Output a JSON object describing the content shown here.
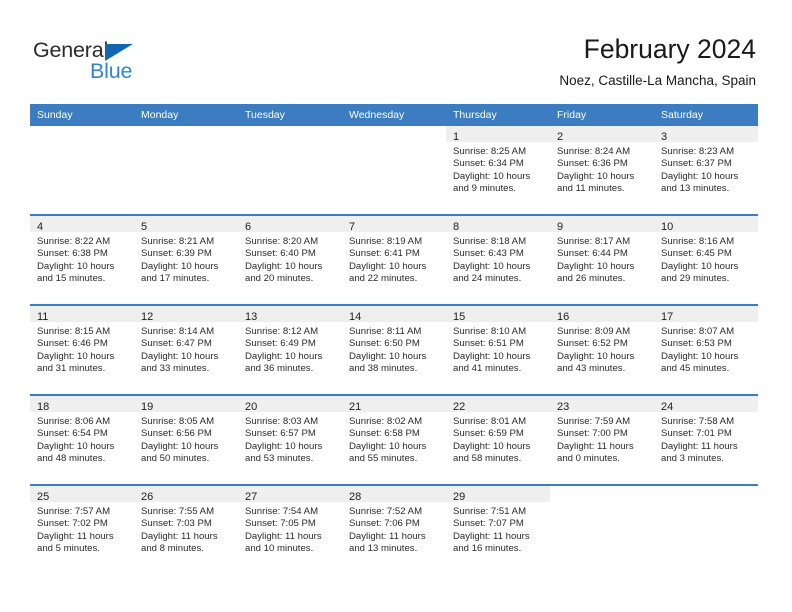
{
  "brand": {
    "name_part1": "General",
    "name_part2": "Blue",
    "triangle_icon": "triangle-icon",
    "color_dark": "#2b2b2b",
    "color_blue": "#2f86d3"
  },
  "header": {
    "title": "February 2024",
    "subtitle": "Noez, Castille-La Mancha, Spain"
  },
  "theme": {
    "header_blue": "#3b7dc0",
    "daynum_band": "#efefef",
    "text": "#2a2a2a"
  },
  "calendar": {
    "weekdays": [
      "Sunday",
      "Monday",
      "Tuesday",
      "Wednesday",
      "Thursday",
      "Friday",
      "Saturday"
    ],
    "weeks": [
      [
        {
          "day": "",
          "lines": []
        },
        {
          "day": "",
          "lines": []
        },
        {
          "day": "",
          "lines": []
        },
        {
          "day": "",
          "lines": []
        },
        {
          "day": "1",
          "lines": [
            "Sunrise: 8:25 AM",
            "Sunset: 6:34 PM",
            "Daylight: 10 hours",
            "and 9 minutes."
          ]
        },
        {
          "day": "2",
          "lines": [
            "Sunrise: 8:24 AM",
            "Sunset: 6:36 PM",
            "Daylight: 10 hours",
            "and 11 minutes."
          ]
        },
        {
          "day": "3",
          "lines": [
            "Sunrise: 8:23 AM",
            "Sunset: 6:37 PM",
            "Daylight: 10 hours",
            "and 13 minutes."
          ]
        }
      ],
      [
        {
          "day": "4",
          "lines": [
            "Sunrise: 8:22 AM",
            "Sunset: 6:38 PM",
            "Daylight: 10 hours",
            "and 15 minutes."
          ]
        },
        {
          "day": "5",
          "lines": [
            "Sunrise: 8:21 AM",
            "Sunset: 6:39 PM",
            "Daylight: 10 hours",
            "and 17 minutes."
          ]
        },
        {
          "day": "6",
          "lines": [
            "Sunrise: 8:20 AM",
            "Sunset: 6:40 PM",
            "Daylight: 10 hours",
            "and 20 minutes."
          ]
        },
        {
          "day": "7",
          "lines": [
            "Sunrise: 8:19 AM",
            "Sunset: 6:41 PM",
            "Daylight: 10 hours",
            "and 22 minutes."
          ]
        },
        {
          "day": "8",
          "lines": [
            "Sunrise: 8:18 AM",
            "Sunset: 6:43 PM",
            "Daylight: 10 hours",
            "and 24 minutes."
          ]
        },
        {
          "day": "9",
          "lines": [
            "Sunrise: 8:17 AM",
            "Sunset: 6:44 PM",
            "Daylight: 10 hours",
            "and 26 minutes."
          ]
        },
        {
          "day": "10",
          "lines": [
            "Sunrise: 8:16 AM",
            "Sunset: 6:45 PM",
            "Daylight: 10 hours",
            "and 29 minutes."
          ]
        }
      ],
      [
        {
          "day": "11",
          "lines": [
            "Sunrise: 8:15 AM",
            "Sunset: 6:46 PM",
            "Daylight: 10 hours",
            "and 31 minutes."
          ]
        },
        {
          "day": "12",
          "lines": [
            "Sunrise: 8:14 AM",
            "Sunset: 6:47 PM",
            "Daylight: 10 hours",
            "and 33 minutes."
          ]
        },
        {
          "day": "13",
          "lines": [
            "Sunrise: 8:12 AM",
            "Sunset: 6:49 PM",
            "Daylight: 10 hours",
            "and 36 minutes."
          ]
        },
        {
          "day": "14",
          "lines": [
            "Sunrise: 8:11 AM",
            "Sunset: 6:50 PM",
            "Daylight: 10 hours",
            "and 38 minutes."
          ]
        },
        {
          "day": "15",
          "lines": [
            "Sunrise: 8:10 AM",
            "Sunset: 6:51 PM",
            "Daylight: 10 hours",
            "and 41 minutes."
          ]
        },
        {
          "day": "16",
          "lines": [
            "Sunrise: 8:09 AM",
            "Sunset: 6:52 PM",
            "Daylight: 10 hours",
            "and 43 minutes."
          ]
        },
        {
          "day": "17",
          "lines": [
            "Sunrise: 8:07 AM",
            "Sunset: 6:53 PM",
            "Daylight: 10 hours",
            "and 45 minutes."
          ]
        }
      ],
      [
        {
          "day": "18",
          "lines": [
            "Sunrise: 8:06 AM",
            "Sunset: 6:54 PM",
            "Daylight: 10 hours",
            "and 48 minutes."
          ]
        },
        {
          "day": "19",
          "lines": [
            "Sunrise: 8:05 AM",
            "Sunset: 6:56 PM",
            "Daylight: 10 hours",
            "and 50 minutes."
          ]
        },
        {
          "day": "20",
          "lines": [
            "Sunrise: 8:03 AM",
            "Sunset: 6:57 PM",
            "Daylight: 10 hours",
            "and 53 minutes."
          ]
        },
        {
          "day": "21",
          "lines": [
            "Sunrise: 8:02 AM",
            "Sunset: 6:58 PM",
            "Daylight: 10 hours",
            "and 55 minutes."
          ]
        },
        {
          "day": "22",
          "lines": [
            "Sunrise: 8:01 AM",
            "Sunset: 6:59 PM",
            "Daylight: 10 hours",
            "and 58 minutes."
          ]
        },
        {
          "day": "23",
          "lines": [
            "Sunrise: 7:59 AM",
            "Sunset: 7:00 PM",
            "Daylight: 11 hours",
            "and 0 minutes."
          ]
        },
        {
          "day": "24",
          "lines": [
            "Sunrise: 7:58 AM",
            "Sunset: 7:01 PM",
            "Daylight: 11 hours",
            "and 3 minutes."
          ]
        }
      ],
      [
        {
          "day": "25",
          "lines": [
            "Sunrise: 7:57 AM",
            "Sunset: 7:02 PM",
            "Daylight: 11 hours",
            "and 5 minutes."
          ]
        },
        {
          "day": "26",
          "lines": [
            "Sunrise: 7:55 AM",
            "Sunset: 7:03 PM",
            "Daylight: 11 hours",
            "and 8 minutes."
          ]
        },
        {
          "day": "27",
          "lines": [
            "Sunrise: 7:54 AM",
            "Sunset: 7:05 PM",
            "Daylight: 11 hours",
            "and 10 minutes."
          ]
        },
        {
          "day": "28",
          "lines": [
            "Sunrise: 7:52 AM",
            "Sunset: 7:06 PM",
            "Daylight: 11 hours",
            "and 13 minutes."
          ]
        },
        {
          "day": "29",
          "lines": [
            "Sunrise: 7:51 AM",
            "Sunset: 7:07 PM",
            "Daylight: 11 hours",
            "and 16 minutes."
          ]
        },
        {
          "day": "",
          "lines": []
        },
        {
          "day": "",
          "lines": []
        }
      ]
    ]
  }
}
